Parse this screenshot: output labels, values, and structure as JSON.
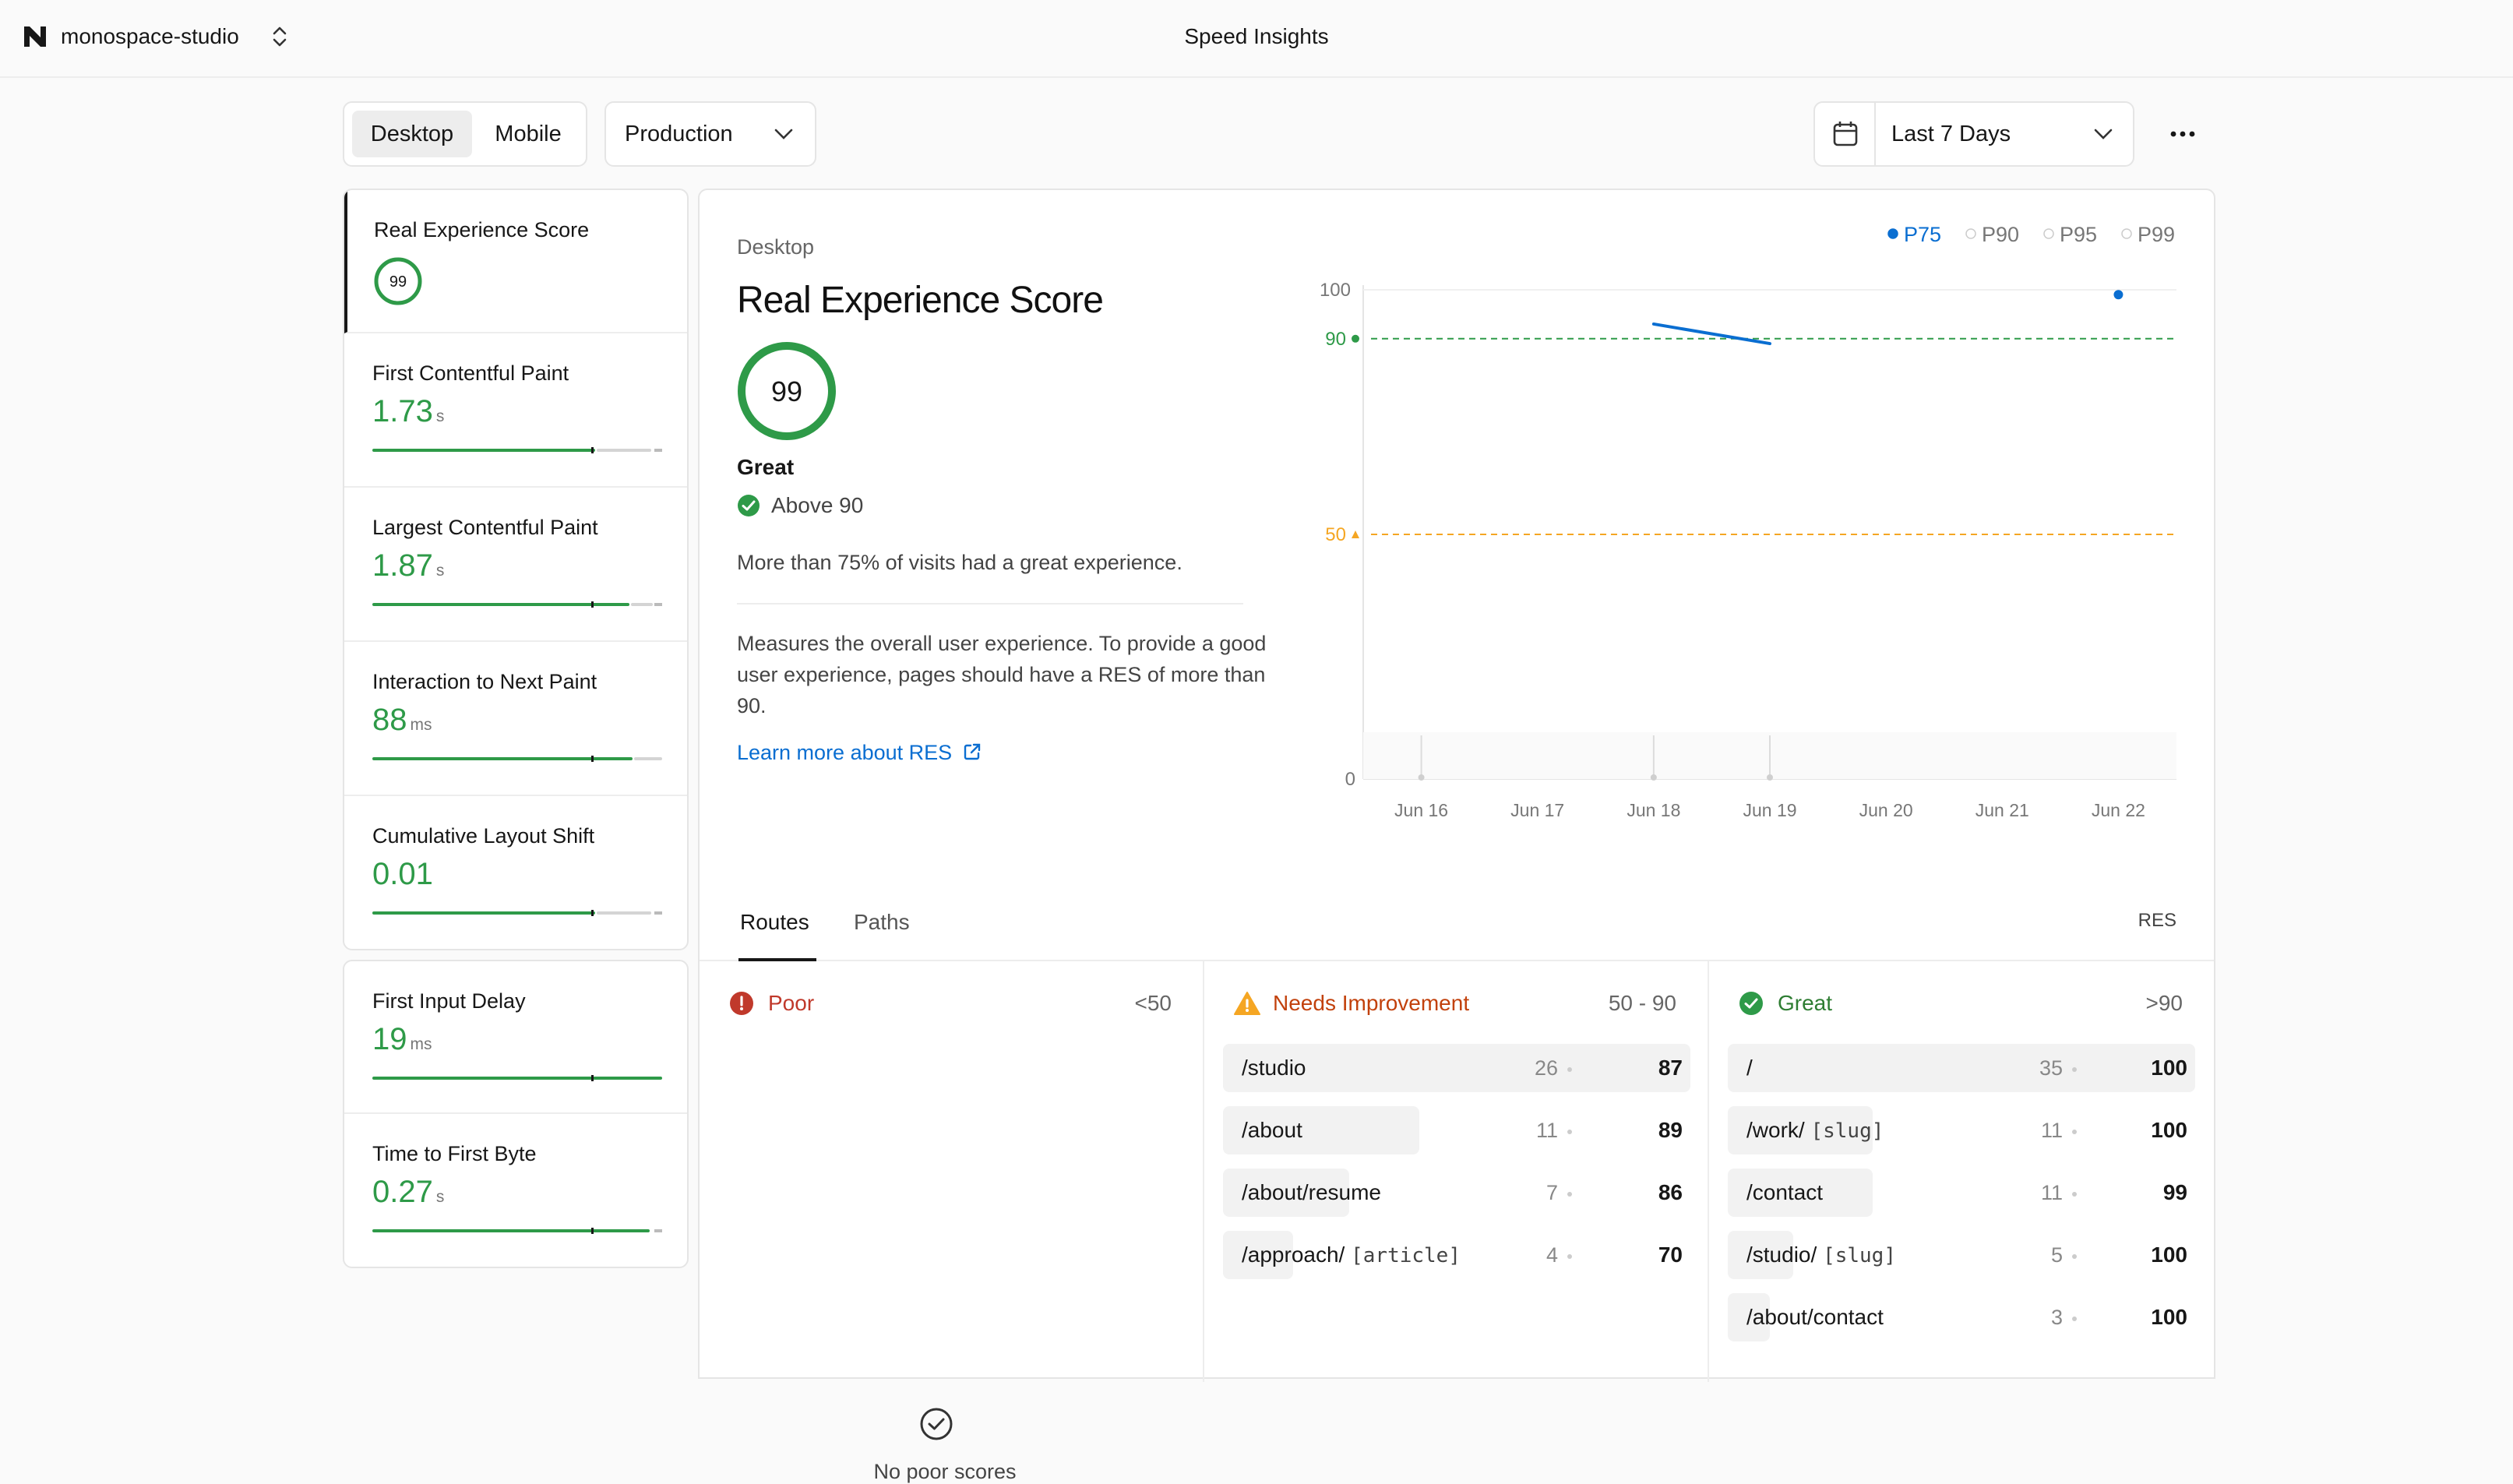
{
  "header": {
    "project": "monospace-studio",
    "title": "Speed Insights"
  },
  "toolbar": {
    "device_tabs": [
      {
        "label": "Desktop",
        "active": true
      },
      {
        "label": "Mobile",
        "active": false
      }
    ],
    "environment": "Production",
    "date_range": "Last 7 Days"
  },
  "metrics": [
    {
      "title": "Real Experience Score",
      "value": "99",
      "unit": "",
      "ring": true,
      "progress": 0.99
    },
    {
      "title": "First Contentful Paint",
      "value": "1.73",
      "unit": "s",
      "progress": 0.75
    },
    {
      "title": "Largest Contentful Paint",
      "value": "1.87",
      "unit": "s",
      "progress": 0.9
    },
    {
      "title": "Interaction to Next Paint",
      "value": "88",
      "unit": "ms",
      "progress": 0.9
    },
    {
      "title": "Cumulative Layout Shift",
      "value": "0.01",
      "unit": "",
      "progress": 0.75
    },
    {
      "title": "First Input Delay",
      "value": "19",
      "unit": "ms",
      "progress": 1.0
    },
    {
      "title": "Time to First Byte",
      "value": "0.27",
      "unit": "s",
      "progress": 0.95
    }
  ],
  "detail": {
    "device": "Desktop",
    "title": "Real Experience Score",
    "score": "99",
    "rating": "Great",
    "threshold_text": "Above 90",
    "summary": "More than 75% of visits had a great experience.",
    "description": "Measures the overall user experience. To provide a good user experience, pages should have a RES of more than 90.",
    "link": "Learn more about RES"
  },
  "chart_data": {
    "type": "line",
    "x": [
      "Jun 16",
      "Jun 17",
      "Jun 18",
      "Jun 19",
      "Jun 20",
      "Jun 21",
      "Jun 22"
    ],
    "percentiles": [
      {
        "label": "P75",
        "active": true
      },
      {
        "label": "P90",
        "active": false
      },
      {
        "label": "P95",
        "active": false
      },
      {
        "label": "P99",
        "active": false
      }
    ],
    "series": [
      {
        "name": "P75",
        "values": [
          null,
          null,
          93,
          89,
          null,
          null,
          99
        ]
      }
    ],
    "y_ticks": [
      "100",
      "0"
    ],
    "thresholds": [
      {
        "value": 90,
        "label": "90",
        "color": "#2e9a48"
      },
      {
        "value": 50,
        "label": "50",
        "color": "#f5a623"
      }
    ],
    "ylim": [
      0,
      100
    ],
    "colors": {
      "line": "#0a6ed1"
    }
  },
  "routes": {
    "tabs": [
      {
        "label": "Routes",
        "active": true
      },
      {
        "label": "Paths",
        "active": false
      }
    ],
    "metric_label": "RES",
    "columns": [
      {
        "label": "Poor",
        "range": "<50",
        "color": "#c0392b",
        "empty_text": "No poor scores",
        "rows": []
      },
      {
        "label": "Needs Improvement",
        "range": "50 - 90",
        "color": "#c2410c",
        "rows": [
          {
            "route": "/studio",
            "slug": "",
            "count": "26",
            "score": "87",
            "share": 1.0
          },
          {
            "route": "/about",
            "slug": "",
            "count": "11",
            "score": "89",
            "share": 0.42
          },
          {
            "route": "/about/resume",
            "slug": "",
            "count": "7",
            "score": "86",
            "share": 0.27
          },
          {
            "route": "/approach/",
            "slug": "[article]",
            "count": "4",
            "score": "70",
            "share": 0.15
          }
        ]
      },
      {
        "label": "Great",
        "range": ">90",
        "color": "#2e7d32",
        "rows": [
          {
            "route": "/",
            "slug": "",
            "count": "35",
            "score": "100",
            "share": 1.0
          },
          {
            "route": "/work/",
            "slug": "[slug]",
            "count": "11",
            "score": "100",
            "share": 0.31
          },
          {
            "route": "/contact",
            "slug": "",
            "count": "11",
            "score": "99",
            "share": 0.31
          },
          {
            "route": "/studio/",
            "slug": "[slug]",
            "count": "5",
            "score": "100",
            "share": 0.14
          },
          {
            "route": "/about/contact",
            "slug": "",
            "count": "3",
            "score": "100",
            "share": 0.09
          }
        ]
      }
    ]
  }
}
